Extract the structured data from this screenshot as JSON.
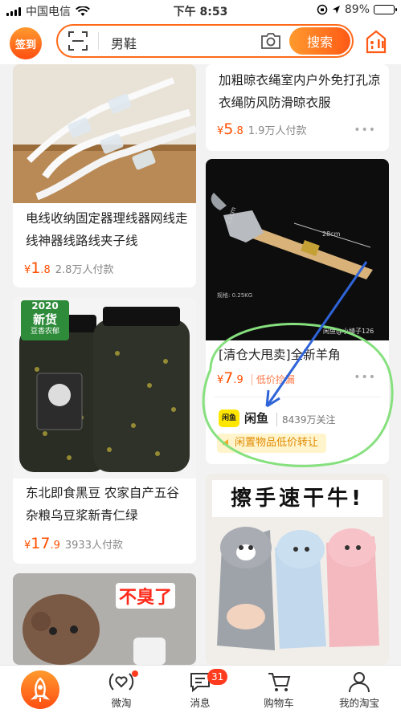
{
  "status_bar": {
    "carrier": "中国电信",
    "time": "下午 8:53",
    "battery": "89%",
    "battery_level": 0.89
  },
  "header": {
    "signin_label": "签到",
    "search_query": "男鞋",
    "search_button": "搜索"
  },
  "feed": {
    "left": [
      {
        "title": "电线收纳固定器理线器网线走线神器线路线夹子线",
        "currency": "¥",
        "price_int": "1",
        "price_dec": ".8",
        "sold": "2.8万人付款"
      },
      {
        "badge_year": "2020",
        "badge_label": "新货",
        "badge_sub": "豆香农郁",
        "title": "东北即食黑豆 农家自产五谷杂粮乌豆浆新青仁绿",
        "currency": "¥",
        "price_int": "17",
        "price_dec": ".9",
        "sold": "3933人付款"
      },
      {
        "overlay_text": "不臭了"
      }
    ],
    "right": [
      {
        "title": "加粗晾衣绳室内户外免打孔凉衣绳防风防滑晾衣服",
        "currency": "¥",
        "price_int": "5",
        "price_dec": ".8",
        "sold": "1.9万人付款"
      },
      {
        "image_label_handle": "11cm",
        "image_label_length": "28cm",
        "image_label_weight": "规格: 0.25KG",
        "image_watermark": "闲鱼@小婧子126",
        "title": "[清仓大甩卖]全新羊角",
        "currency": "¥",
        "price_int": "7",
        "price_dec": ".9",
        "tag": "低价捡漏",
        "logo_text": "闲鱼",
        "shop_name": "闲鱼",
        "followers": "8439万关注",
        "promo": "闲置物品低价转让"
      },
      {
        "banner": "擦手速干牛!"
      }
    ],
    "more_glyph": "•••"
  },
  "tabbar": {
    "items": [
      {
        "label": ""
      },
      {
        "label": "微淘"
      },
      {
        "label": "消息",
        "badge": "31"
      },
      {
        "label": "购物车"
      },
      {
        "label": "我的淘宝"
      }
    ]
  },
  "colors": {
    "accent": "#ff5a16",
    "price": "#ff4f00",
    "highlight_circle": "#7ee07a",
    "highlight_arrow": "#2f64d8"
  }
}
